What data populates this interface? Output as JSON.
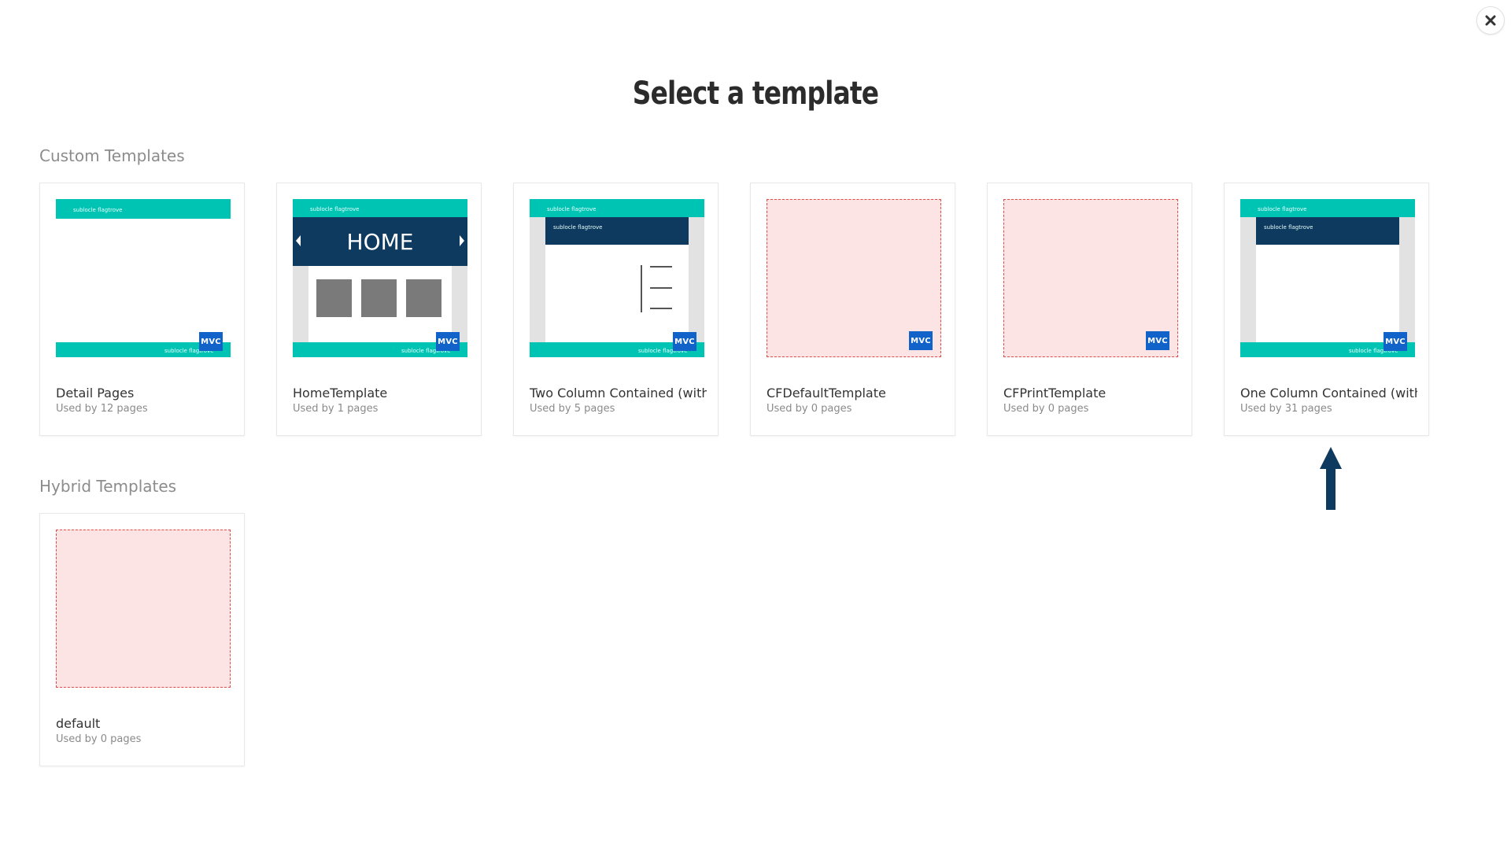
{
  "dialog": {
    "title": "Select a template",
    "close_icon": "close-icon"
  },
  "sections": [
    {
      "title": "Custom Templates",
      "templates": [
        {
          "name": "Detail Pages",
          "usage": "Used by 12 pages",
          "badge": "MVC",
          "thumb": "detail"
        },
        {
          "name": "HomeTemplate",
          "usage": "Used by 1 pages",
          "badge": "MVC",
          "thumb": "home"
        },
        {
          "name": "Two Column Contained (with ...",
          "usage": "Used by 5 pages",
          "badge": "MVC",
          "thumb": "twocol"
        },
        {
          "name": "CFDefaultTemplate",
          "usage": "Used by 0 pages",
          "badge": "MVC",
          "thumb": "empty"
        },
        {
          "name": "CFPrintTemplate",
          "usage": "Used by 0 pages",
          "badge": "MVC",
          "thumb": "empty"
        },
        {
          "name": "One Column Contained (with ...",
          "usage": "Used by 31 pages",
          "badge": "MVC",
          "thumb": "onecol"
        }
      ]
    },
    {
      "title": "Hybrid Templates",
      "templates": [
        {
          "name": "default",
          "usage": "Used by 0 pages",
          "thumb": "empty"
        }
      ]
    }
  ],
  "thumb_text": {
    "header_text": "sublocle flagtrove",
    "home_banner": "HOME"
  },
  "annotation": {
    "icon": "arrow-up-icon",
    "color": "#0d3a5e"
  },
  "colors": {
    "teal": "#00c4b3",
    "navy": "#0d3a5e",
    "mvc": "#1162c9",
    "placeholder": "#fde4e4",
    "placeholder_border": "#e24a4a"
  }
}
